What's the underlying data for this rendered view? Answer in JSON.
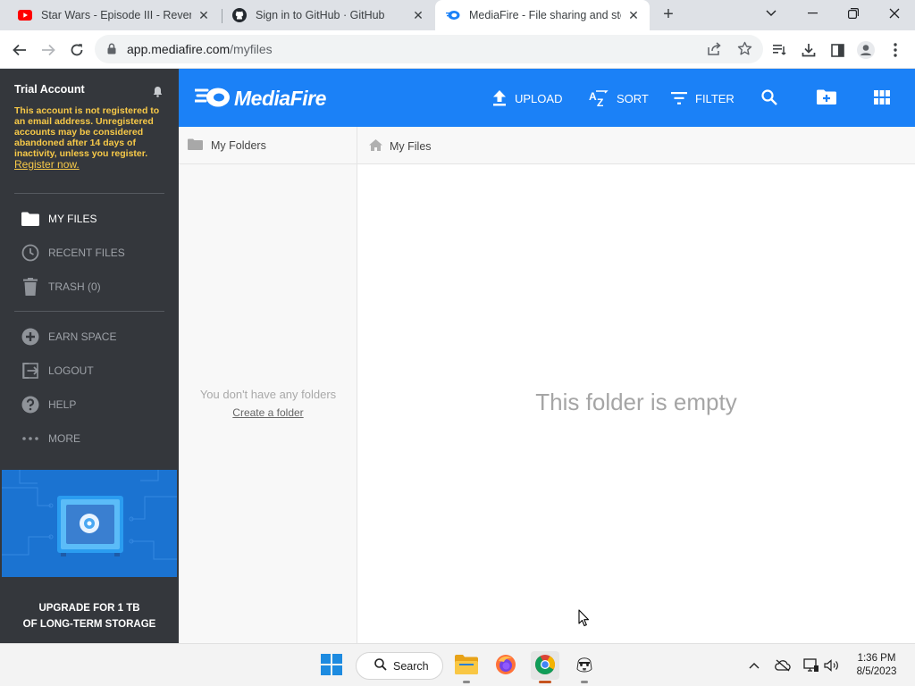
{
  "browser": {
    "tabs": [
      {
        "title": "Star Wars - Episode III - Revenge",
        "close": "✕",
        "icon": "youtube-icon"
      },
      {
        "title": "Sign in to GitHub · GitHub",
        "close": "✕",
        "icon": "github-icon"
      },
      {
        "title": "MediaFire - File sharing and stora",
        "close": "✕",
        "icon": "mediafire-icon",
        "active": true
      }
    ],
    "new_tab": "+",
    "address": {
      "host": "app.mediafire.com",
      "path": "/myfiles"
    }
  },
  "sidebar": {
    "account_title": "Trial Account",
    "warning": "This account is not registered to an email address. Unregistered accounts may be considered abandoned after 14 days of inactivity, unless you register.",
    "register_link": "Register now.",
    "nav_primary": [
      {
        "label": "MY FILES",
        "icon": "folder-icon",
        "active": true
      },
      {
        "label": "RECENT FILES",
        "icon": "clock-icon"
      },
      {
        "label": "TRASH (0)",
        "icon": "trash-icon"
      }
    ],
    "nav_secondary": [
      {
        "label": "EARN SPACE",
        "icon": "plus-circle-icon"
      },
      {
        "label": "LOGOUT",
        "icon": "logout-icon"
      },
      {
        "label": "HELP",
        "icon": "help-icon"
      },
      {
        "label": "MORE",
        "icon": "more-icon"
      }
    ],
    "promo": {
      "line1": "UPGRADE FOR 1 TB",
      "line2": "OF LONG-TERM STORAGE"
    }
  },
  "header": {
    "logo_text": "MediaFire",
    "actions": [
      {
        "label": "UPLOAD",
        "icon": "upload-icon"
      },
      {
        "label": "SORT",
        "icon": "sort-az-icon"
      },
      {
        "label": "FILTER",
        "icon": "filter-icon"
      }
    ]
  },
  "folders_pane": {
    "title": "My Folders",
    "empty_text": "You don't have any folders",
    "create_link": "Create a folder"
  },
  "files_pane": {
    "breadcrumb": "My Files",
    "empty_text": "This folder is empty"
  },
  "taskbar": {
    "search_label": "Search",
    "time": "1:36 PM",
    "date": "8/5/2023"
  },
  "colors": {
    "brand_blue": "#1b81f7",
    "sidebar_bg": "#34373c",
    "warning_yellow": "#f7c948"
  }
}
